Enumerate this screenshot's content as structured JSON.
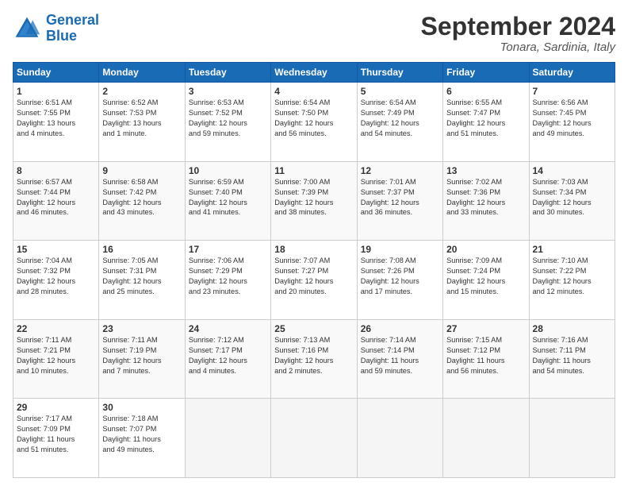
{
  "logo": {
    "line1": "General",
    "line2": "Blue"
  },
  "title": "September 2024",
  "location": "Tonara, Sardinia, Italy",
  "days_of_week": [
    "Sunday",
    "Monday",
    "Tuesday",
    "Wednesday",
    "Thursday",
    "Friday",
    "Saturday"
  ],
  "weeks": [
    [
      {
        "day": 1,
        "info": "Sunrise: 6:51 AM\nSunset: 7:55 PM\nDaylight: 13 hours\nand 4 minutes."
      },
      {
        "day": 2,
        "info": "Sunrise: 6:52 AM\nSunset: 7:53 PM\nDaylight: 13 hours\nand 1 minute."
      },
      {
        "day": 3,
        "info": "Sunrise: 6:53 AM\nSunset: 7:52 PM\nDaylight: 12 hours\nand 59 minutes."
      },
      {
        "day": 4,
        "info": "Sunrise: 6:54 AM\nSunset: 7:50 PM\nDaylight: 12 hours\nand 56 minutes."
      },
      {
        "day": 5,
        "info": "Sunrise: 6:54 AM\nSunset: 7:49 PM\nDaylight: 12 hours\nand 54 minutes."
      },
      {
        "day": 6,
        "info": "Sunrise: 6:55 AM\nSunset: 7:47 PM\nDaylight: 12 hours\nand 51 minutes."
      },
      {
        "day": 7,
        "info": "Sunrise: 6:56 AM\nSunset: 7:45 PM\nDaylight: 12 hours\nand 49 minutes."
      }
    ],
    [
      {
        "day": 8,
        "info": "Sunrise: 6:57 AM\nSunset: 7:44 PM\nDaylight: 12 hours\nand 46 minutes."
      },
      {
        "day": 9,
        "info": "Sunrise: 6:58 AM\nSunset: 7:42 PM\nDaylight: 12 hours\nand 43 minutes."
      },
      {
        "day": 10,
        "info": "Sunrise: 6:59 AM\nSunset: 7:40 PM\nDaylight: 12 hours\nand 41 minutes."
      },
      {
        "day": 11,
        "info": "Sunrise: 7:00 AM\nSunset: 7:39 PM\nDaylight: 12 hours\nand 38 minutes."
      },
      {
        "day": 12,
        "info": "Sunrise: 7:01 AM\nSunset: 7:37 PM\nDaylight: 12 hours\nand 36 minutes."
      },
      {
        "day": 13,
        "info": "Sunrise: 7:02 AM\nSunset: 7:36 PM\nDaylight: 12 hours\nand 33 minutes."
      },
      {
        "day": 14,
        "info": "Sunrise: 7:03 AM\nSunset: 7:34 PM\nDaylight: 12 hours\nand 30 minutes."
      }
    ],
    [
      {
        "day": 15,
        "info": "Sunrise: 7:04 AM\nSunset: 7:32 PM\nDaylight: 12 hours\nand 28 minutes."
      },
      {
        "day": 16,
        "info": "Sunrise: 7:05 AM\nSunset: 7:31 PM\nDaylight: 12 hours\nand 25 minutes."
      },
      {
        "day": 17,
        "info": "Sunrise: 7:06 AM\nSunset: 7:29 PM\nDaylight: 12 hours\nand 23 minutes."
      },
      {
        "day": 18,
        "info": "Sunrise: 7:07 AM\nSunset: 7:27 PM\nDaylight: 12 hours\nand 20 minutes."
      },
      {
        "day": 19,
        "info": "Sunrise: 7:08 AM\nSunset: 7:26 PM\nDaylight: 12 hours\nand 17 minutes."
      },
      {
        "day": 20,
        "info": "Sunrise: 7:09 AM\nSunset: 7:24 PM\nDaylight: 12 hours\nand 15 minutes."
      },
      {
        "day": 21,
        "info": "Sunrise: 7:10 AM\nSunset: 7:22 PM\nDaylight: 12 hours\nand 12 minutes."
      }
    ],
    [
      {
        "day": 22,
        "info": "Sunrise: 7:11 AM\nSunset: 7:21 PM\nDaylight: 12 hours\nand 10 minutes."
      },
      {
        "day": 23,
        "info": "Sunrise: 7:11 AM\nSunset: 7:19 PM\nDaylight: 12 hours\nand 7 minutes."
      },
      {
        "day": 24,
        "info": "Sunrise: 7:12 AM\nSunset: 7:17 PM\nDaylight: 12 hours\nand 4 minutes."
      },
      {
        "day": 25,
        "info": "Sunrise: 7:13 AM\nSunset: 7:16 PM\nDaylight: 12 hours\nand 2 minutes."
      },
      {
        "day": 26,
        "info": "Sunrise: 7:14 AM\nSunset: 7:14 PM\nDaylight: 11 hours\nand 59 minutes."
      },
      {
        "day": 27,
        "info": "Sunrise: 7:15 AM\nSunset: 7:12 PM\nDaylight: 11 hours\nand 56 minutes."
      },
      {
        "day": 28,
        "info": "Sunrise: 7:16 AM\nSunset: 7:11 PM\nDaylight: 11 hours\nand 54 minutes."
      }
    ],
    [
      {
        "day": 29,
        "info": "Sunrise: 7:17 AM\nSunset: 7:09 PM\nDaylight: 11 hours\nand 51 minutes."
      },
      {
        "day": 30,
        "info": "Sunrise: 7:18 AM\nSunset: 7:07 PM\nDaylight: 11 hours\nand 49 minutes."
      },
      null,
      null,
      null,
      null,
      null
    ]
  ]
}
